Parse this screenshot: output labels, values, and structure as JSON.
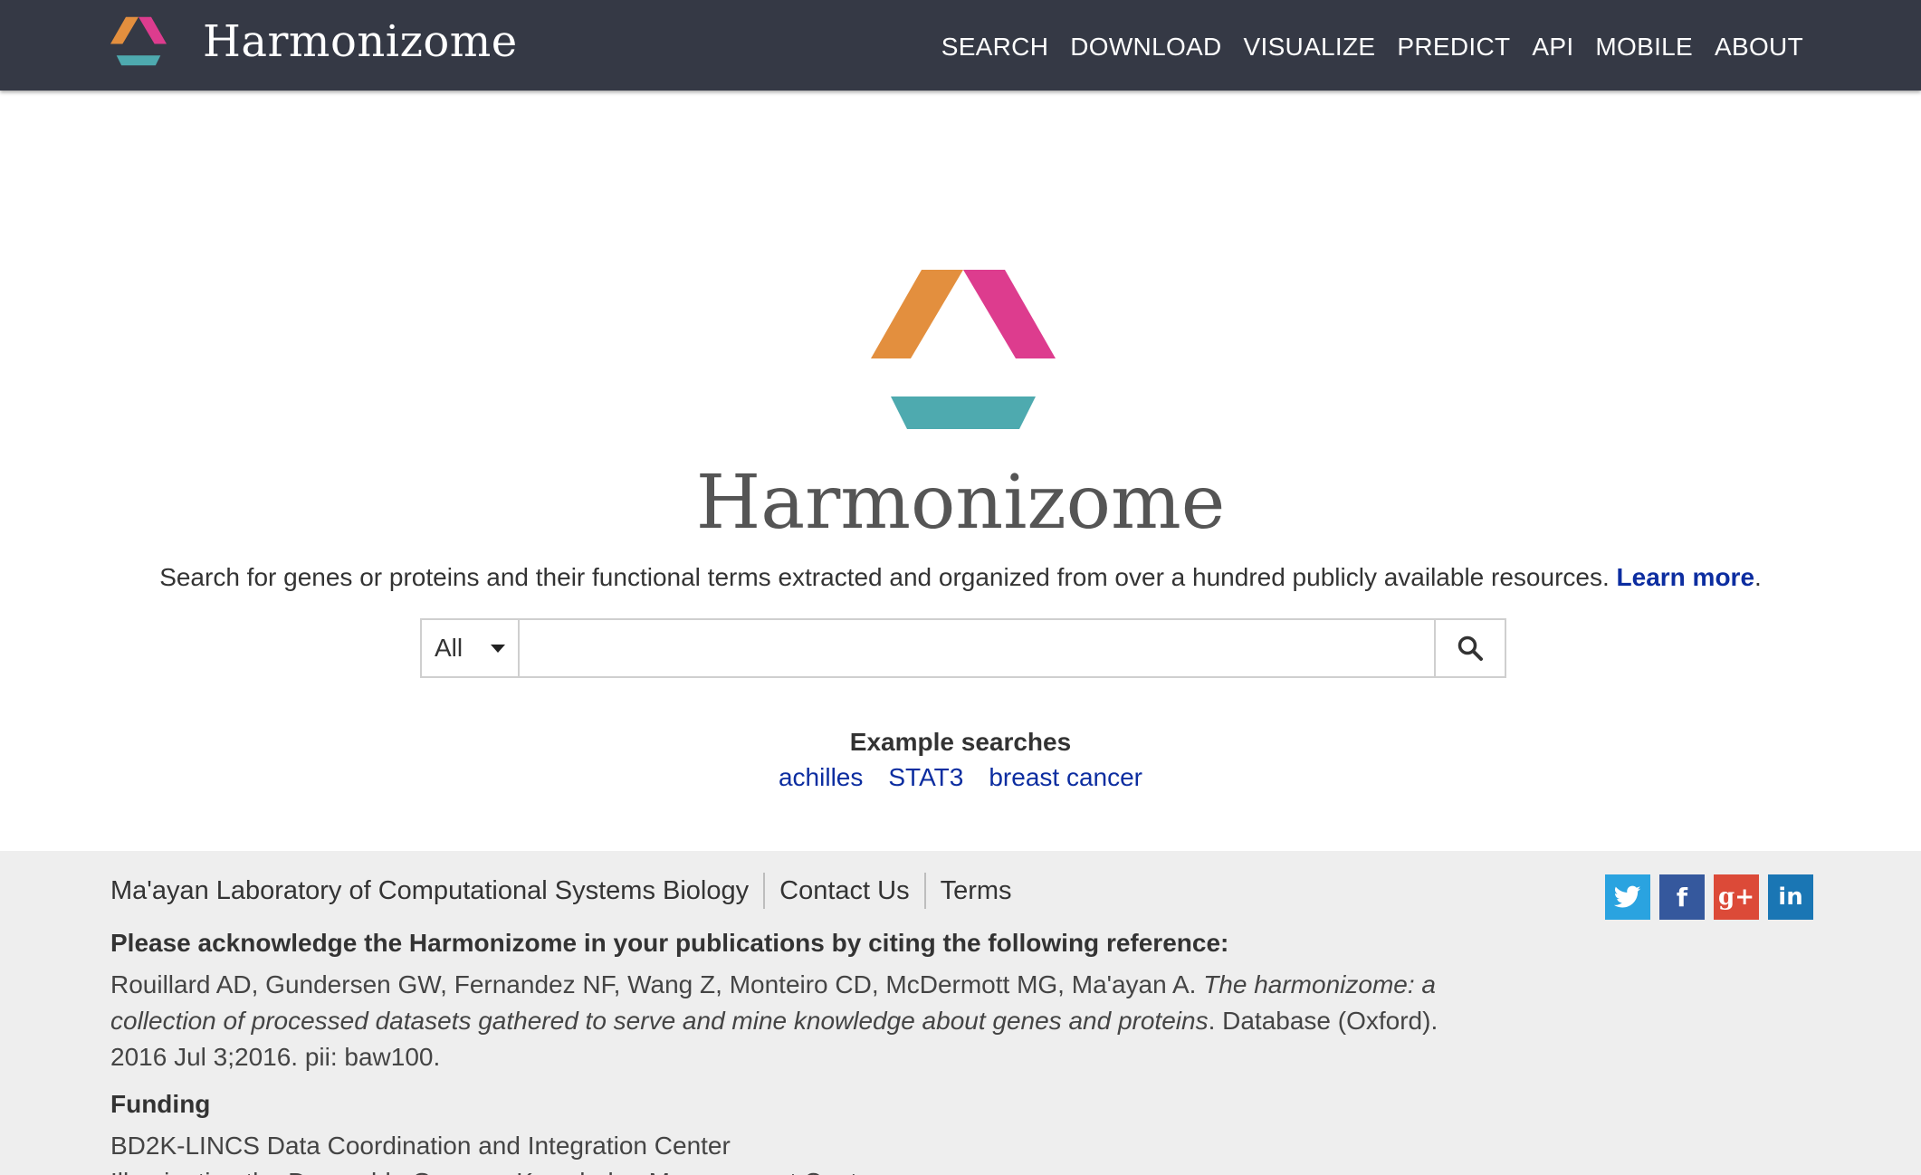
{
  "navbar": {
    "brand": "Harmonizome",
    "links": [
      "SEARCH",
      "DOWNLOAD",
      "VISUALIZE",
      "PREDICT",
      "API",
      "MOBILE",
      "ABOUT"
    ]
  },
  "hero": {
    "title": "Harmonizome",
    "tagline": "Search for genes or proteins and their functional terms extracted and organized from over a hundred publicly available resources.",
    "learn_more": "Learn more"
  },
  "search": {
    "category": "All",
    "value": "",
    "placeholder": ""
  },
  "examples": {
    "title": "Example searches",
    "items": [
      "achilles",
      "STAT3",
      "breast cancer"
    ]
  },
  "footer": {
    "links": [
      "Ma'ayan Laboratory of Computational Systems Biology",
      "Contact Us",
      "Terms"
    ],
    "cite_heading": "Please acknowledge the Harmonizome in your publications by citing the following reference:",
    "citation_authors": "Rouillard AD, Gundersen GW, Fernandez NF, Wang Z, Monteiro CD, McDermott MG, Ma'ayan A.",
    "citation_title": "The harmonizome: a collection of processed datasets gathered to serve and mine knowledge about genes and proteins",
    "citation_source": ". Database (Oxford). 2016 Jul 3;2016. pii: baw100.",
    "funding_heading": "Funding",
    "funding_items": [
      "BD2K-LINCS Data Coordination and Integration Center",
      "Illuminating the Druggable Genome Knowledge Management Center"
    ],
    "social": [
      {
        "icon": "twitter-icon",
        "glyph": ""
      },
      {
        "icon": "facebook-icon",
        "glyph": "f"
      },
      {
        "icon": "google-plus-icon",
        "glyph": "g+"
      },
      {
        "icon": "linkedin-icon",
        "glyph": "in"
      }
    ]
  },
  "colors": {
    "navbar": "#353945",
    "logo_orange": "#e38f3e",
    "logo_pink": "#dd3c8e",
    "logo_teal": "#4eaaaf",
    "link": "#0c2da0"
  }
}
